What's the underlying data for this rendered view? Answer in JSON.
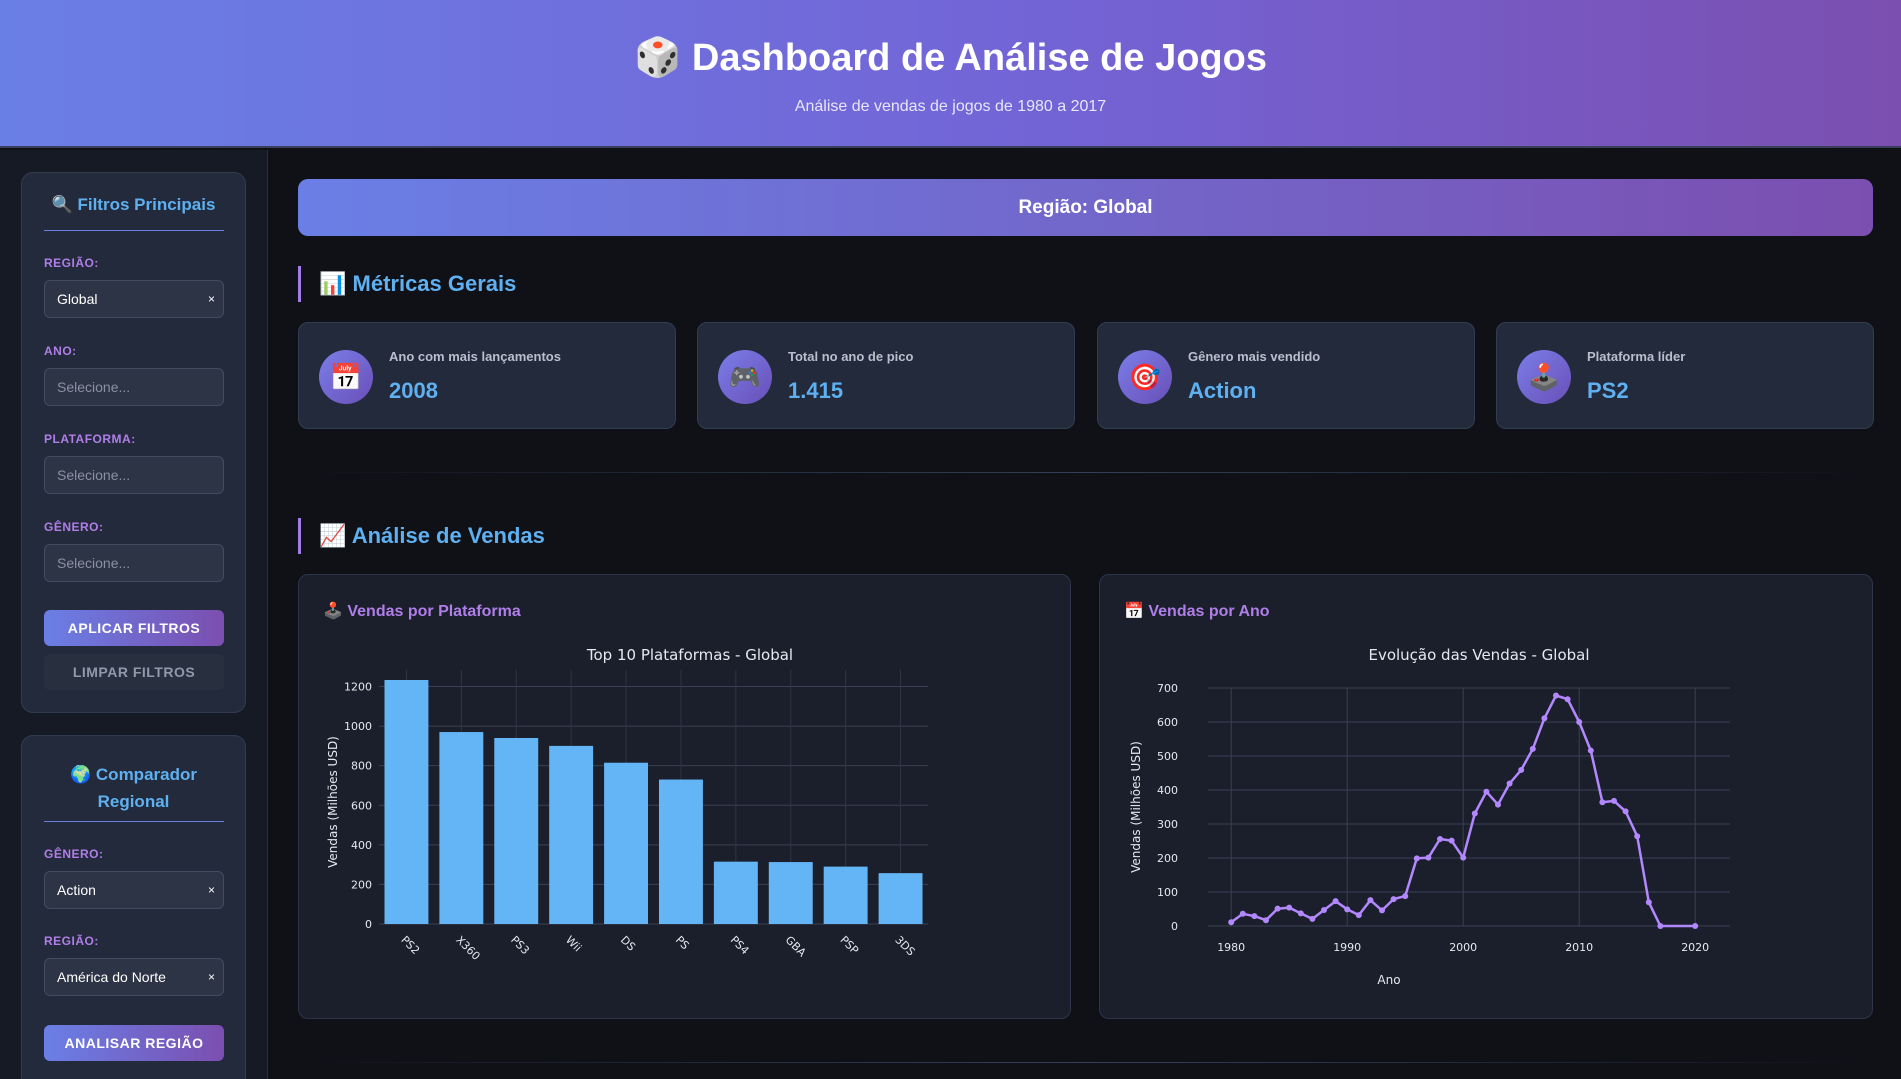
{
  "header": {
    "title": "🎲 Dashboard de Análise de Jogos",
    "subtitle": "Análise de vendas de jogos de 1980 a 2017"
  },
  "sidebar": {
    "filters": {
      "title": "🔍 Filtros Principais",
      "region_label": "REGIÃO:",
      "region_value": "Global",
      "year_label": "ANO:",
      "year_placeholder": "Selecione...",
      "platform_label": "PLATAFORMA:",
      "platform_placeholder": "Selecione...",
      "genre_label": "GÊNERO:",
      "genre_placeholder": "Selecione...",
      "apply_label": "APLICAR FILTROS",
      "clear_label": "LIMPAR FILTROS"
    },
    "comparator": {
      "title_line1": "🌍 Comparador",
      "title_line2": "Regional",
      "genre_label": "GÊNERO:",
      "genre_value": "Action",
      "region_label": "REGIÃO:",
      "region_value": "América do Norte",
      "analyze_label": "ANALISAR REGIÃO"
    },
    "clear_glyph": "×"
  },
  "main": {
    "region_banner": "Região: Global",
    "metrics_title": "📊 Métricas Gerais",
    "metrics": [
      {
        "icon": "calendar-icon",
        "glyph": "📅",
        "label": "Ano com mais lançamentos",
        "value": "2008"
      },
      {
        "icon": "gamepad-icon",
        "glyph": "🎮",
        "label": "Total no ano de pico",
        "value": "1.415"
      },
      {
        "icon": "target-icon",
        "glyph": "🎯",
        "label": "Gênero mais vendido",
        "value": "Action"
      },
      {
        "icon": "joystick-icon",
        "glyph": "🕹️",
        "label": "Plataforma líder",
        "value": "PS2"
      }
    ],
    "sales_title": "📈 Análise de Vendas",
    "platform_card_title": "🕹️ Vendas por Plataforma",
    "year_card_title": "📅 Vendas por Ano"
  },
  "colors": {
    "accent_blue": "#5fb0f0",
    "accent_purple": "#b07ee8",
    "bar": "#64b5f6",
    "line": "#b388ff"
  },
  "chart_data": [
    {
      "type": "bar",
      "title": "Top 10 Plataformas - Global",
      "xlabel": "",
      "ylabel": "Vendas (Milhões USD)",
      "categories": [
        "PS2",
        "X360",
        "PS3",
        "Wii",
        "DS",
        "PS",
        "PS4",
        "GBA",
        "PSP",
        "3DS"
      ],
      "values": [
        1233,
        970,
        940,
        900,
        815,
        730,
        315,
        313,
        290,
        257
      ],
      "ylim": [
        0,
        1233
      ],
      "yticks": [
        0,
        200,
        400,
        600,
        800,
        1000,
        1200
      ],
      "grid": true
    },
    {
      "type": "line",
      "title": "Evolução das Vendas - Global",
      "xlabel": "Ano",
      "ylabel": "Vendas (Milhões USD)",
      "x": [
        1980,
        1981,
        1982,
        1983,
        1984,
        1985,
        1986,
        1987,
        1988,
        1989,
        1990,
        1991,
        1992,
        1993,
        1994,
        1995,
        1996,
        1997,
        1998,
        1999,
        2000,
        2001,
        2002,
        2003,
        2004,
        2005,
        2006,
        2007,
        2008,
        2009,
        2010,
        2011,
        2012,
        2013,
        2014,
        2015,
        2016,
        2017,
        2020
      ],
      "y": [
        11,
        36,
        29,
        17,
        51,
        54,
        37,
        21,
        47,
        73,
        49,
        32,
        76,
        46,
        79,
        88,
        199,
        201,
        256,
        251,
        201,
        331,
        395,
        357,
        419,
        459,
        521,
        611,
        678,
        667,
        600,
        516,
        364,
        368,
        337,
        264,
        70,
        0,
        0
      ],
      "xlim": [
        1978,
        2023
      ],
      "xticks": [
        1980,
        1990,
        2000,
        2010,
        2020
      ],
      "ylim": [
        0,
        700
      ],
      "yticks": [
        0,
        100,
        200,
        300,
        400,
        500,
        600,
        700
      ],
      "grid": true
    }
  ]
}
